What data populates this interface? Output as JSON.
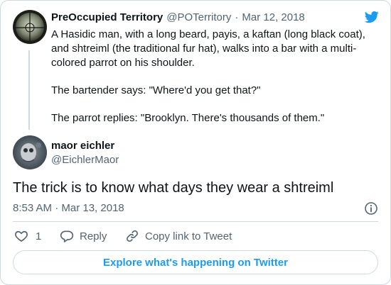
{
  "quoted_tweet": {
    "author_name": "PreOccupied Territory",
    "author_handle": "@POTerritory",
    "separator": "·",
    "date": "Mar 12, 2018",
    "paragraphs": [
      "A Hasidic man, with a long beard, payis, a kaftan (long black coat), and shtreiml (the traditional fur hat), walks into a bar with a multi-colored parrot on his shoulder.",
      "The bartender says: \"Where'd you get that?\"",
      "The parrot replies: \"Brooklyn. There's thousands of them.\""
    ]
  },
  "reply_tweet": {
    "author_name": "maor eichler",
    "author_handle": "@EichlerMaor",
    "text": "The trick is to know what days they wear a shtreiml",
    "timestamp": "8:53 AM · Mar 13, 2018"
  },
  "actions": {
    "like_count": "1",
    "reply_label": "Reply",
    "copy_link_label": "Copy link to Tweet"
  },
  "explore_button_label": "Explore what's happening on Twitter",
  "colors": {
    "twitter_blue": "#1d9bf0",
    "text_primary": "#0f1419",
    "text_secondary": "#536471",
    "border": "#cfd9de"
  },
  "icons": [
    "twitter-bird-icon",
    "info-icon",
    "heart-icon",
    "reply-bubble-icon",
    "link-icon"
  ]
}
